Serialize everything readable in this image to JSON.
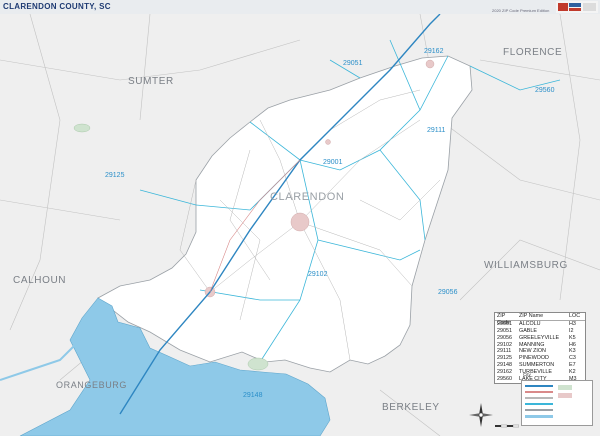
{
  "header": {
    "title": "CLARENDON COUNTY, SC",
    "edition": "2020 ZIP Code Premium Edition"
  },
  "map": {
    "center_label": "CLARENDON",
    "neighbors": {
      "sumter": "SUMTER",
      "florence": "FLORENCE",
      "calhoun": "CALHOUN",
      "williamsburg": "WILLIAMSBURG",
      "orangeburg": "ORANGEBURG",
      "berkeley": "BERKELEY"
    },
    "zip_labels": {
      "z29162": "29162",
      "z29051": "29051",
      "z29560": "29560",
      "z29111": "29111",
      "z29001": "29001",
      "z29125": "29125",
      "z29102": "29102",
      "z29056": "29056",
      "z29148": "29148"
    },
    "colors": {
      "water": "#8ec9e8",
      "county_fill": "#ffffff",
      "outside_fill": "#efefef",
      "zip_boundary": "#3bb6d9",
      "interstate": "#2e86c1",
      "roads": "#b0b0b0"
    }
  },
  "legend": {
    "headers": {
      "zip": "ZIP Code",
      "name": "ZIP Name",
      "loc": "LOC"
    },
    "rows": [
      {
        "zip": "29001",
        "name": "ALCOLU",
        "loc": "H3"
      },
      {
        "zip": "29051",
        "name": "GABLE",
        "loc": "I2"
      },
      {
        "zip": "29056",
        "name": "GREELEYVILLE",
        "loc": "K5"
      },
      {
        "zip": "29102",
        "name": "MANNING",
        "loc": "H6"
      },
      {
        "zip": "29111",
        "name": "NEW ZION",
        "loc": "K3"
      },
      {
        "zip": "29125",
        "name": "PINEWOOD",
        "loc": "C3"
      },
      {
        "zip": "29148",
        "name": "SUMMERTON",
        "loc": "E7"
      },
      {
        "zip": "29162",
        "name": "TURBEVILLE",
        "loc": "K2"
      },
      {
        "zip": "29560",
        "name": "LAKE CITY",
        "loc": "M3"
      }
    ]
  },
  "map_key": {
    "city": "City"
  }
}
